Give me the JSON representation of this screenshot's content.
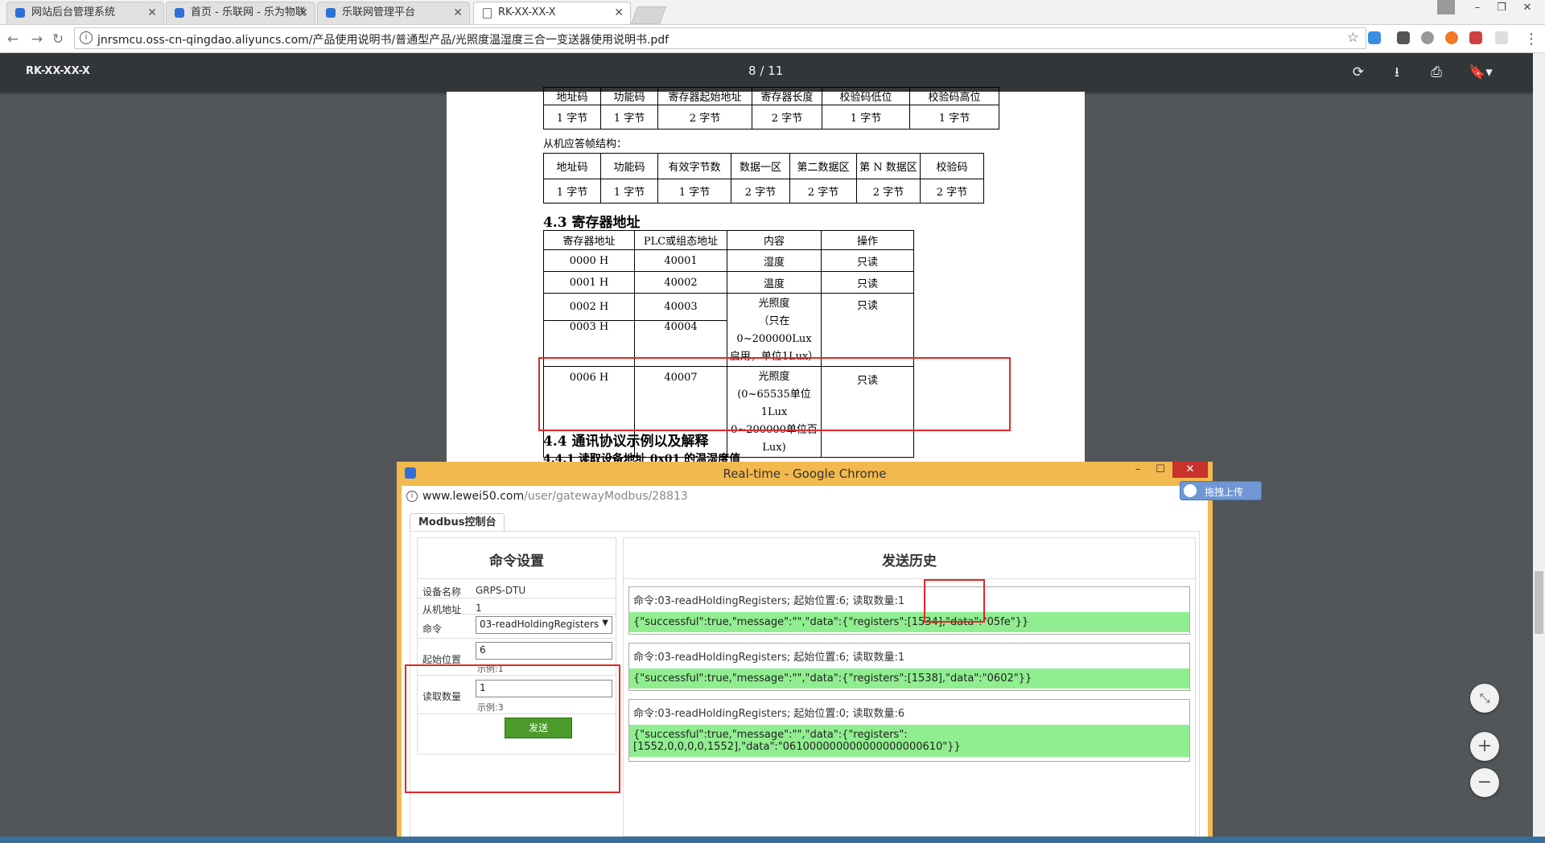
{
  "tabs": [
    {
      "label": "网站后台管理系统"
    },
    {
      "label": "首页 - 乐联网 - 乐为物联"
    },
    {
      "label": "乐联网管理平台"
    },
    {
      "label": "RK-XX-XX-X"
    }
  ],
  "address": {
    "url": "jnrsmcu.oss-cn-qingdao.aliyuncs.com/产品使用说明书/普通型产品/光照度温湿度三合一变送器使用说明书.pdf"
  },
  "pdf": {
    "title": "RK-XX-XX-X",
    "page_current": "8",
    "page_sep": "/",
    "page_total": "11"
  },
  "doc": {
    "table1_header": [
      "地址码",
      "功能码",
      "寄存器起始地址",
      "寄存器长度",
      "校验码低位",
      "校验码高位"
    ],
    "table1_row": [
      "1 字节",
      "1 字节",
      "2 字节",
      "2 字节",
      "1 字节",
      "1 字节"
    ],
    "slave_label": "从机应答帧结构：",
    "table2_header": [
      "地址码",
      "功能码",
      "有效字节数",
      "数据一区",
      "第二数据区",
      "第 N 数据区",
      "校验码"
    ],
    "table2_row": [
      "1 字节",
      "1 字节",
      "1 字节",
      "2 字节",
      "2 字节",
      "2 字节",
      "2 字节"
    ],
    "sec43": "4.3  寄存器地址",
    "reg_header": [
      "寄存器地址",
      "PLC或组态地址",
      "内容",
      "操作"
    ],
    "reg_rows": [
      [
        "0000 H",
        "40001",
        "湿度",
        "只读"
      ],
      [
        "0001 H",
        "40002",
        "温度",
        "只读"
      ],
      [
        "0002 H",
        "40003"
      ],
      [
        "0003 H",
        "40004"
      ],
      [
        "0006 H",
        "40007"
      ]
    ],
    "lux_content_1": "光照度",
    "lux_content_2": "（只在0~200000Lux",
    "lux_content_3": "启用，单位1Lux）",
    "lux_op": "只读",
    "lux2_content_1": "光照度",
    "lux2_content_2": "(0~65535单位1Lux",
    "lux2_content_3": "0~200000单位百Lux)",
    "lux2_op": "只读",
    "sec44": "4.4  通讯协议示例以及解释",
    "sec441": "4.4.1  读取设备地址 0x01 的温湿度值"
  },
  "popup": {
    "title": "Real-time - Google Chrome",
    "url_host": "www.lewei50.com",
    "url_path": "/user/gatewayModbus/28813",
    "upload_badge": "拖拽上传",
    "tab": "Modbus控制台",
    "left_title": "命令设置",
    "fields": {
      "device_label": "设备名称",
      "device_value": "GRPS-DTU",
      "slave_label": "从机地址",
      "slave_value": "1",
      "cmd_label": "命令",
      "cmd_value": "03-readHoldingRegisters",
      "start_label": "起始位置",
      "start_value": "6",
      "start_hint": "示例:1",
      "count_label": "读取数量",
      "count_value": "1",
      "count_hint": "示例:3",
      "send": "发送"
    },
    "right_title": "发送历史",
    "history": [
      {
        "cmd": "命令:03-readHoldingRegisters; 起始位置:6; 读取数量:1",
        "resp": "{\"successful\":true,\"message\":\"\",\"data\":{\"registers\":[1534],\"data\":\"05fe\"}}"
      },
      {
        "cmd": "命令:03-readHoldingRegisters; 起始位置:6; 读取数量:1",
        "resp": "{\"successful\":true,\"message\":\"\",\"data\":{\"registers\":[1538],\"data\":\"0602\"}}"
      },
      {
        "cmd": "命令:03-readHoldingRegisters; 起始位置:0; 读取数量:6",
        "resp": "{\"successful\":true,\"message\":\"\",\"data\":{\"registers\":\n[1552,0,0,0,0,1552],\"data\":\"061000000000000000000610\"}}"
      }
    ]
  }
}
